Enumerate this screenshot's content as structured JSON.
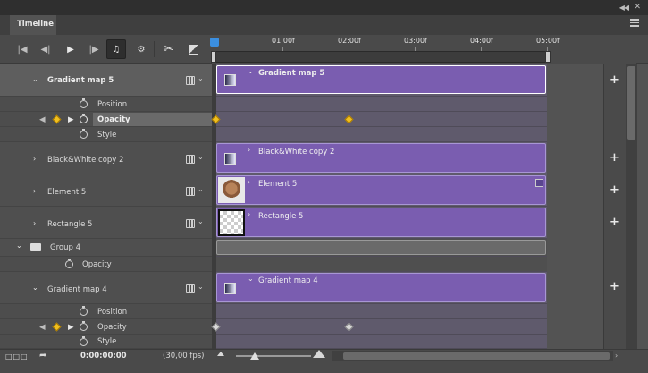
{
  "panel": {
    "tab": "Timeline",
    "collapse_icon": "double-chevron-icon",
    "close_icon": "close-icon"
  },
  "ruler": {
    "ticks": [
      "01:00f",
      "02:00f",
      "03:00f",
      "04:00f",
      "05:00f"
    ]
  },
  "layers": [
    {
      "name": "Gradient map 5",
      "selected": true,
      "clip_label": "Gradient map 5",
      "props": [
        "Position",
        "Opacity",
        "Style"
      ],
      "active_prop": "Opacity"
    },
    {
      "name": "Black&White copy 2",
      "clip_label": "Black&White copy 2"
    },
    {
      "name": "Element 5",
      "clip_label": "Element 5"
    },
    {
      "name": "Rectangle 5",
      "clip_label": "Rectangle 5"
    },
    {
      "name": "Group 4",
      "group_prop": "Opacity"
    },
    {
      "name": "Gradient map 4",
      "clip_label": "Gradient map 4",
      "props": [
        "Position",
        "Opacity",
        "Style"
      ]
    }
  ],
  "footer": {
    "timecode": "0:00:00:00",
    "fps": "(30,00 fps)"
  },
  "colors": {
    "clip": "#7a5db0",
    "playhead": "#e03a3a",
    "keyframe": "#f0c020"
  }
}
